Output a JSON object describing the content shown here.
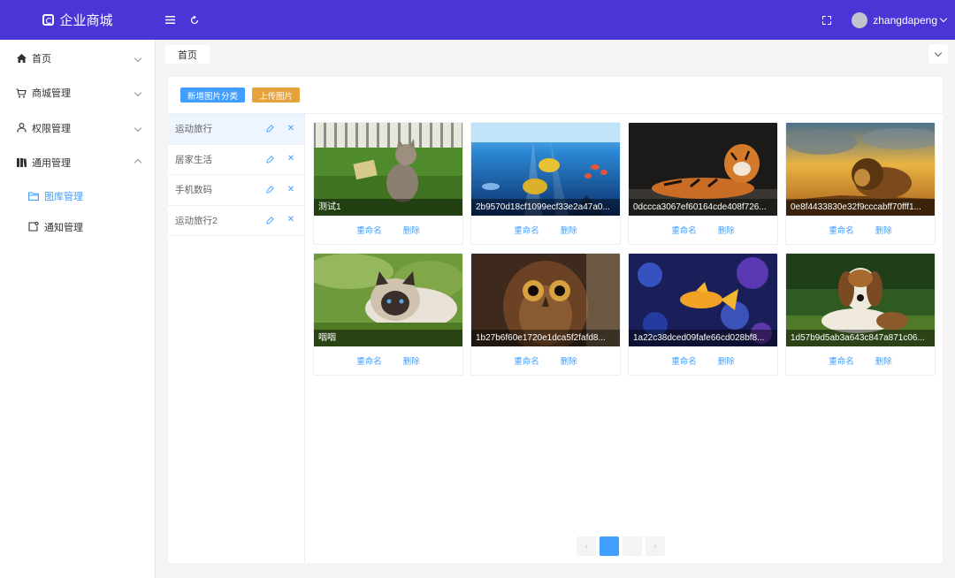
{
  "header": {
    "brand": "企业商城",
    "username": "zhangdapeng"
  },
  "colors": {
    "header_bg": "#4a35d6",
    "primary": "#409eff",
    "warning": "#e6a23c"
  },
  "sidebar": {
    "items": [
      {
        "label": "首页",
        "icon": "home-icon",
        "expanded": false
      },
      {
        "label": "商城管理",
        "icon": "shop-icon",
        "expanded": false
      },
      {
        "label": "权限管理",
        "icon": "user-icon",
        "expanded": false
      },
      {
        "label": "通用管理",
        "icon": "book-icon",
        "expanded": true
      }
    ],
    "subitems": [
      {
        "label": "图库管理",
        "icon": "folder-icon",
        "active": true
      },
      {
        "label": "通知管理",
        "icon": "notice-icon",
        "active": false
      }
    ]
  },
  "tabs": [
    {
      "label": "首页"
    }
  ],
  "toolbar": {
    "add_category": "新增图片分类",
    "upload": "上传图片"
  },
  "categories": [
    {
      "name": "运动旅行",
      "active": true
    },
    {
      "name": "居家生活",
      "active": false
    },
    {
      "name": "手机数码",
      "active": false
    },
    {
      "name": "运动旅行2",
      "active": false
    }
  ],
  "image_actions": {
    "rename": "重命名",
    "delete": "删除"
  },
  "images": [
    {
      "caption": "测试1",
      "subject": "cat-on-grass"
    },
    {
      "caption": "2b9570d18cf1099ecf33e2a47a0...",
      "subject": "fish-underwater"
    },
    {
      "caption": "0dccca3067ef60164cde408f726...",
      "subject": "tiger"
    },
    {
      "caption": "0e8f4433830e32f9cccabff70fff1...",
      "subject": "lion-sunset"
    },
    {
      "caption": "咽咽",
      "subject": "siamese-cat"
    },
    {
      "caption": "1b27b6f60e1720e1dca5f2fafd8...",
      "subject": "owl"
    },
    {
      "caption": "1a22c38dced09fafe66cd028bf8...",
      "subject": "goldfish"
    },
    {
      "caption": "1d57b9d5ab3a643c847a871c06...",
      "subject": "beagle"
    }
  ],
  "pagination": {
    "pages": [
      "",
      ""
    ],
    "current": 1
  }
}
